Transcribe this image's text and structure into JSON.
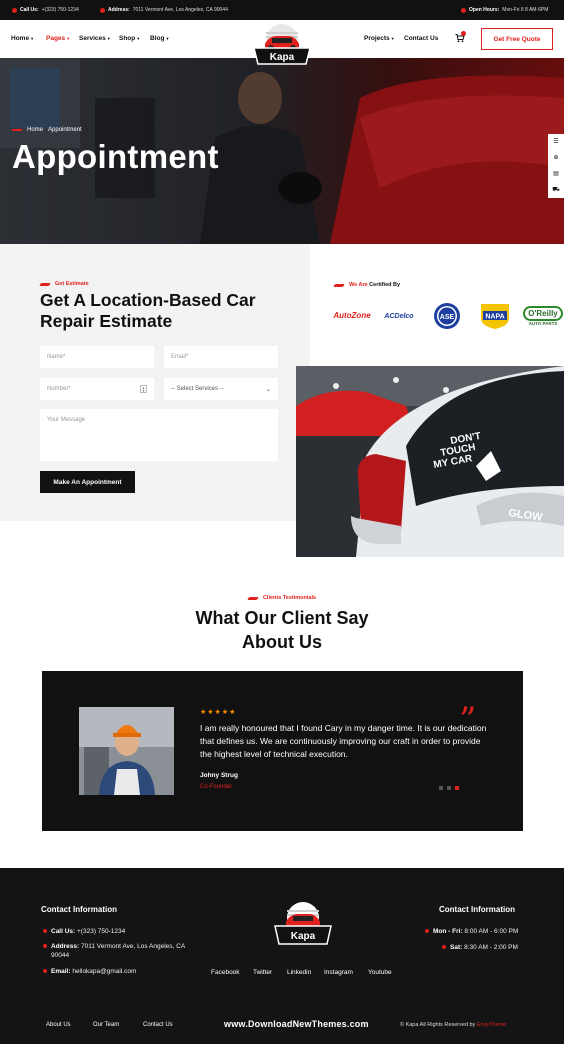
{
  "topbar": {
    "call_label": "Call Us:",
    "call_value": "+(323) 750-1234",
    "address_label": "Address:",
    "address_value": "7011 Vermont Ave, Los Angeles, CA 90044",
    "hours_label": "Open Hours:",
    "hours_value": "Mon-Fri II 8 AM-6PM"
  },
  "nav": {
    "items": [
      {
        "label": "Home",
        "dropdown": true
      },
      {
        "label": "Pages",
        "dropdown": true,
        "active": true
      },
      {
        "label": "Services",
        "dropdown": true
      },
      {
        "label": "Shop",
        "dropdown": true
      },
      {
        "label": "Blog",
        "dropdown": true
      }
    ],
    "right_items": [
      {
        "label": "Projects",
        "dropdown": true
      },
      {
        "label": "Contact Us"
      }
    ],
    "logo_text": "Kapa",
    "quote_button": "Get Free Quote"
  },
  "hero": {
    "breadcrumb_home": "Home",
    "breadcrumb_current": "Appointment",
    "title": "Appointment"
  },
  "estimate": {
    "kicker": "Get Estimate",
    "title": "Get A Location-Based Car Repair Estimate",
    "name_placeholder": "Name*",
    "email_placeholder": "Email*",
    "number_placeholder": "Number*",
    "service_select": "-- Select Services --",
    "message_placeholder": "Your Message",
    "submit": "Make An Appointment"
  },
  "certified": {
    "kicker_prefix": "We Are",
    "kicker_suffix": " Certified By",
    "brands": [
      "AutoZone",
      "ACDelco",
      "ASE",
      "NAPA",
      "O'Reilly AUTO PARTS"
    ]
  },
  "car_sticker": {
    "line1": "DON'T",
    "line2": "TOUCH",
    "line3": "MY CAR",
    "brand": "GLOW"
  },
  "testimonials": {
    "kicker": "Clients Testimonials",
    "title_line1": "What Our Client Say",
    "title_line2": "About Us",
    "stars": "★★★★★",
    "quote": "I am really honoured that I found Cary in my danger time. It is our dedication that defines us. We are continuously improving our craft in order to provide the highest level of technical execution.",
    "name": "Johny Strug",
    "role": "Co-Founder"
  },
  "footer": {
    "left_title": "Contact Information",
    "right_title": "Contact Information",
    "call_label": "Call Us:",
    "call_value": "+(323) 750-1234",
    "address_label": "Address:",
    "address_value": "7011 Vermont Ave, Los Angeles, CA 90044",
    "email_label": "Email:",
    "email_value": "hellokapa@gmail.com",
    "hours1_label": "Mon - Fri:",
    "hours1_value": "8:00 AM - 6:00 PM",
    "hours2_label": "Sat:",
    "hours2_value": "8:30 AM - 2:00 PM",
    "logo_text": "Kapa",
    "social": [
      "Facebook",
      "Twitter",
      "Linkedin",
      "Instagram",
      "Youtube"
    ],
    "bottom_links": [
      "About Us",
      "Our Team",
      "Contact Us"
    ],
    "watermark": "www.DownloadNewThemes.com",
    "copyright_prefix": "© Kapa All Rights Reserved by ",
    "copyright_brand": "EnvyTheme"
  },
  "colors": {
    "accent": "#e0201c",
    "dark": "#111111",
    "light_bg": "#f3f3f3",
    "star": "#ff8a00"
  }
}
